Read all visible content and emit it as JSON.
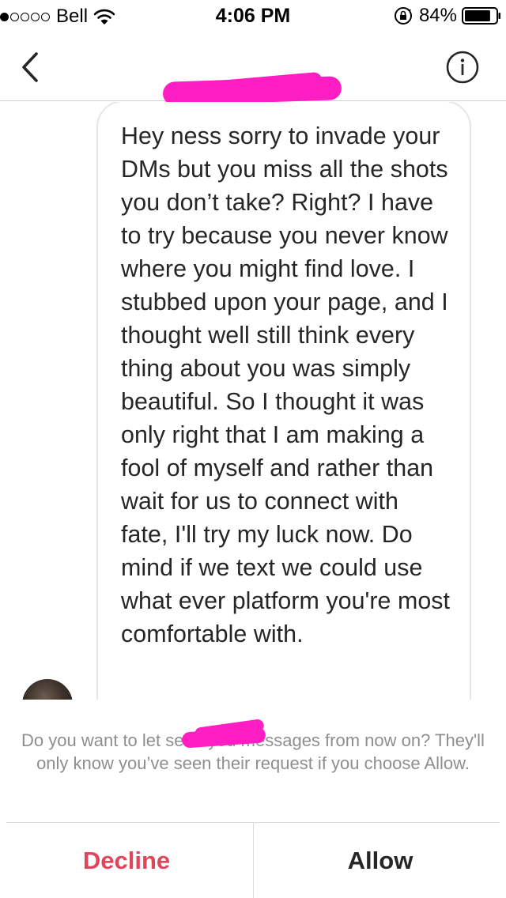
{
  "status_bar": {
    "carrier": "Bell",
    "signal_bars": 1,
    "signal_total": 5,
    "time": "4:06 PM",
    "battery_percent": "84%",
    "battery_level": 0.84,
    "icons": [
      "signal-dots-icon",
      "wifi-icon",
      "orientation-lock-icon",
      "battery-icon"
    ]
  },
  "nav": {
    "back_icon": "chevron-left-icon",
    "info_icon": "info-circle-icon"
  },
  "message": {
    "text": "Hey ness sorry to invade your DMs but you miss all the shots you don’t take? Right? I have to try because you never know where you might find love. I stubbed upon your page, and I thought well still think every thing about you was simply beautiful. So I thought it was only right that I am making a fool of myself and rather than wait for us to connect with fate, I'll try my luck now. Do mind if we text we could use what ever platform you're most comfortable with."
  },
  "request": {
    "prompt": "Do you want to let  send you messages from now on? They'll only know you’ve seen their request if you choose Allow.",
    "decline_label": "Decline",
    "allow_label": "Allow"
  },
  "colors": {
    "decline": "#e0455a",
    "allow": "#262626",
    "secondary_text": "#8e8e8e",
    "redaction": "#ff1ec4"
  }
}
